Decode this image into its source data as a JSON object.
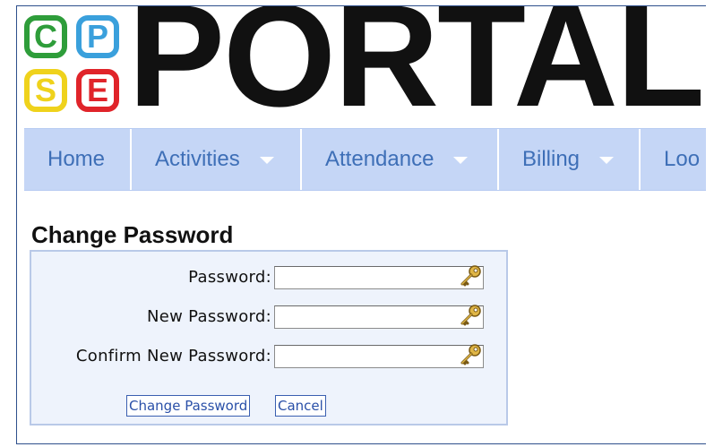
{
  "logo": {
    "letters": [
      "C",
      "P",
      "S",
      "E"
    ],
    "word": "PORTAL",
    "colors": {
      "c": "#2e9d3a",
      "p": "#3aa0dc",
      "s": "#efd21c",
      "e": "#e0242a"
    }
  },
  "nav": {
    "items": [
      {
        "label": "Home",
        "has_dropdown": false
      },
      {
        "label": "Activities",
        "has_dropdown": true
      },
      {
        "label": "Attendance",
        "has_dropdown": true
      },
      {
        "label": "Billing",
        "has_dropdown": true
      },
      {
        "label": "Loo",
        "has_dropdown": false
      }
    ]
  },
  "form": {
    "title": "Change Password",
    "fields": [
      {
        "label": "Password:",
        "value": "",
        "icon": "key-icon"
      },
      {
        "label": "New Password:",
        "value": "",
        "icon": "key-icon"
      },
      {
        "label": "Confirm New Password:",
        "value": "",
        "icon": "key-icon"
      }
    ],
    "submit_label": "Change Password",
    "cancel_label": "Cancel"
  },
  "colors": {
    "nav_bg": "#c5d6f6",
    "nav_text": "#3e6fb7",
    "panel_bg": "#eef3fc",
    "panel_border": "#b9c9e8",
    "button_text": "#2a50a8"
  }
}
